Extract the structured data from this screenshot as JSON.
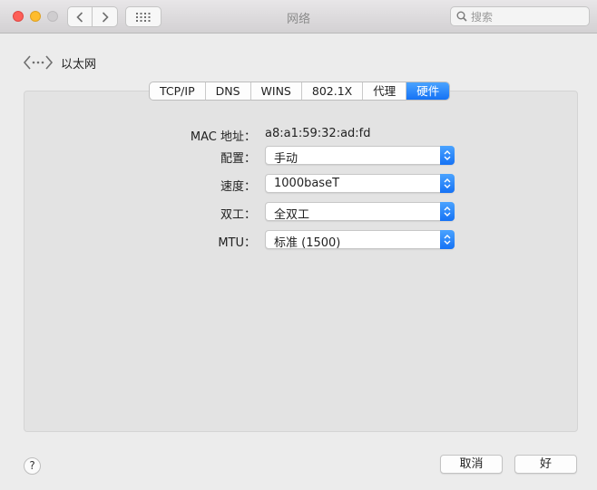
{
  "window": {
    "title": "网络",
    "search_placeholder": "搜索"
  },
  "back": {
    "label": "以太网"
  },
  "tabs": [
    {
      "label": "TCP/IP"
    },
    {
      "label": "DNS"
    },
    {
      "label": "WINS"
    },
    {
      "label": "802.1X"
    },
    {
      "label": "代理"
    },
    {
      "label": "硬件",
      "active": true
    }
  ],
  "hardware": {
    "mac_label": "MAC 地址：",
    "mac_value": "a8:a1:59:32:ad:fd",
    "config_label": "配置：",
    "config_value": "手动",
    "speed_label": "速度：",
    "speed_value": "1000baseT",
    "duplex_label": "双工：",
    "duplex_value": "全双工",
    "mtu_label": "MTU：",
    "mtu_value": "标准 (1500)"
  },
  "footer": {
    "help": "?",
    "cancel": "取消",
    "ok": "好"
  },
  "colors": {
    "accent": "#1a7cf8",
    "window_bg": "#ececec",
    "panel_bg": "#e3e3e3"
  }
}
